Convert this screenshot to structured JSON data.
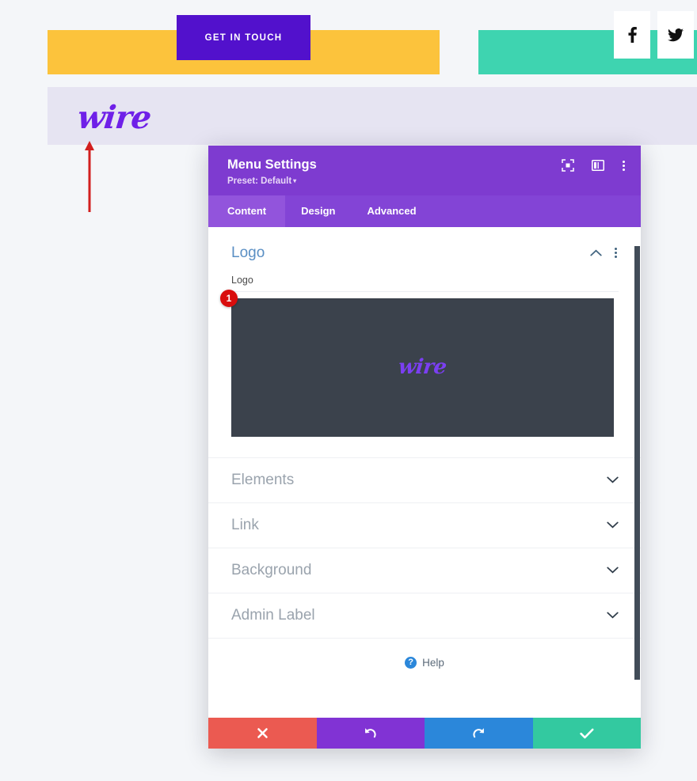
{
  "page": {
    "cta_button_label": "GET IN TOUCH",
    "site_logo_text": "wire",
    "social": [
      {
        "name": "facebook",
        "glyph": "facebook-icon"
      },
      {
        "name": "twitter",
        "glyph": "twitter-icon"
      }
    ],
    "colors": {
      "yellow_bar": "#fcc33c",
      "teal_bar": "#3ed4b0",
      "cta_purple": "#5211cc",
      "logo_purple": "#6f20e8",
      "lavender_band": "#e6e4f2",
      "page_bg": "#f4f6f9"
    },
    "annotation": {
      "arrow_color": "#d21f1f",
      "arrow_points_to": "site-logo"
    }
  },
  "modal": {
    "title": "Menu Settings",
    "preset_label": "Preset: Default",
    "preset_caret": "▾",
    "header_icons": [
      {
        "name": "focus-target-icon"
      },
      {
        "name": "panel-layout-icon"
      },
      {
        "name": "more-options-icon"
      }
    ],
    "tabs": [
      {
        "label": "Content",
        "active": true
      },
      {
        "label": "Design",
        "active": false
      },
      {
        "label": "Advanced",
        "active": false
      }
    ],
    "open_section": {
      "title": "Logo",
      "field_label": "Logo",
      "image_logo_text": "wire",
      "step_badge": "1",
      "collapse_icon": "chevron-up-icon",
      "menu_icon": "more-options-icon"
    },
    "accordion_sections": [
      {
        "label": "Elements"
      },
      {
        "label": "Link"
      },
      {
        "label": "Background"
      },
      {
        "label": "Admin Label"
      }
    ],
    "help": {
      "label": "Help",
      "icon_glyph": "?"
    },
    "footer_buttons": [
      {
        "name": "cancel-button",
        "icon": "close-icon",
        "color": "#eb5a51"
      },
      {
        "name": "undo-button",
        "icon": "undo-icon",
        "color": "#8133d4"
      },
      {
        "name": "redo-button",
        "icon": "redo-icon",
        "color": "#2b87da"
      },
      {
        "name": "save-button",
        "icon": "check-icon",
        "color": "#33c9a0"
      }
    ],
    "colors": {
      "header_purple": "#7e3bd0",
      "tabbar_purple": "#8344d6",
      "tab_active_purple": "#9254dc",
      "section_title_blue": "#5a8fc4",
      "accordion_gray": "#9aa3ad",
      "image_bg": "#3b424c",
      "scrollbar": "#414c58",
      "badge_red": "#d90d0d"
    }
  }
}
